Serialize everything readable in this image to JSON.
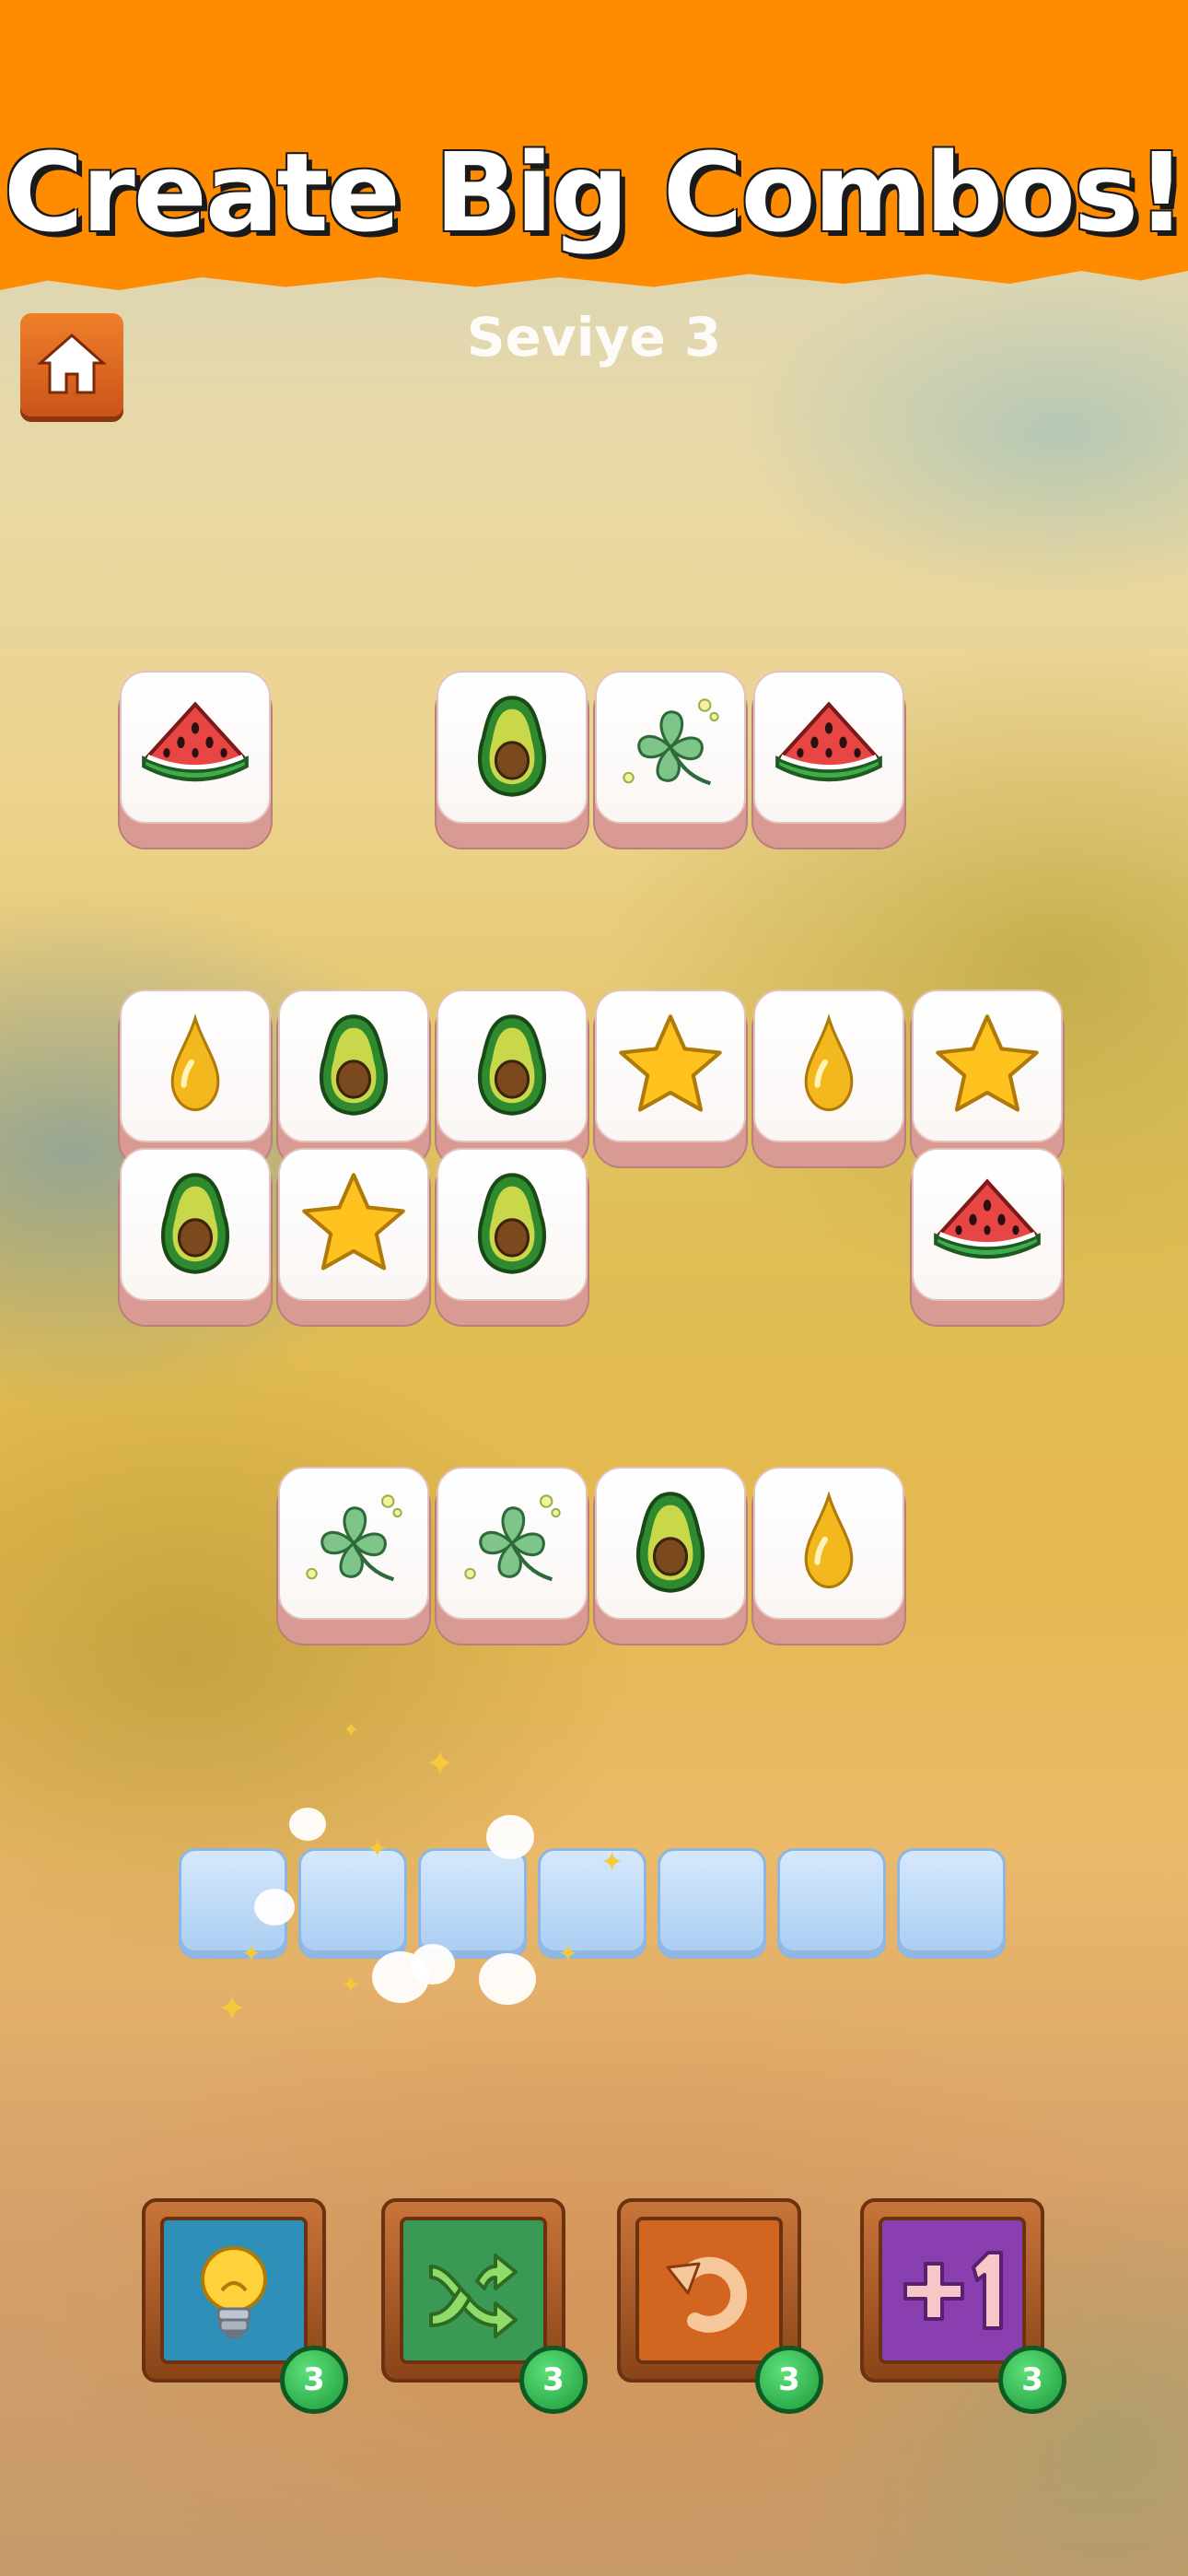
{
  "banner": {
    "title": "Create Big Combos!"
  },
  "header": {
    "level_label": "Seviye 3"
  },
  "board": {
    "tiles": [
      {
        "icon": "watermelon-icon"
      },
      {
        "icon": "avocado-icon"
      },
      {
        "icon": "clover-icon"
      },
      {
        "icon": "watermelon-icon"
      },
      {
        "icon": "oil-drop-icon"
      },
      {
        "icon": "avocado-icon"
      },
      {
        "icon": "avocado-icon"
      },
      {
        "icon": "star-icon"
      },
      {
        "icon": "oil-drop-icon"
      },
      {
        "icon": "star-icon"
      },
      {
        "icon": "avocado-icon"
      },
      {
        "icon": "star-icon"
      },
      {
        "icon": "avocado-icon"
      },
      {
        "icon": "watermelon-icon"
      },
      {
        "icon": "clover-icon"
      },
      {
        "icon": "clover-icon"
      },
      {
        "icon": "avocado-icon"
      },
      {
        "icon": "oil-drop-icon"
      }
    ]
  },
  "tray": {
    "slot_count": 7
  },
  "boosters": [
    {
      "name": "hint",
      "icon": "lightbulb-icon",
      "count": "3",
      "color": "#2e8fb8"
    },
    {
      "name": "shuffle",
      "icon": "shuffle-icon",
      "count": "3",
      "color": "#3a9a55"
    },
    {
      "name": "undo",
      "icon": "undo-icon",
      "count": "3",
      "color": "#d2651f"
    },
    {
      "name": "extra-slot",
      "icon": "plus-one-icon",
      "count": "3",
      "color": "#8a3fb0"
    }
  ]
}
